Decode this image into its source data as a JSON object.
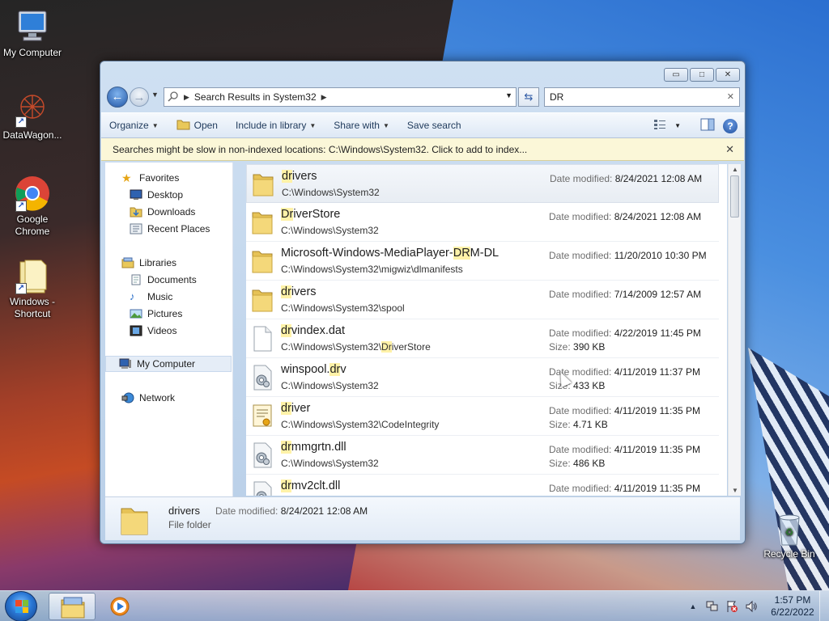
{
  "desktop": {
    "icons": [
      {
        "label": "My Computer"
      },
      {
        "label": "DataWagon..."
      },
      {
        "label": "Google Chrome"
      },
      {
        "label": "Windows - Shortcut"
      },
      {
        "label": "Recycle Bin"
      }
    ]
  },
  "window": {
    "controls": {
      "minimize": "▭",
      "maximize": "□",
      "close": "✕"
    },
    "address": {
      "breadcrumb": "Search Results in System32",
      "search_value": "DR",
      "search_clear": "✕"
    },
    "toolbar": {
      "organize": "Organize",
      "open": "Open",
      "include_in_library": "Include in library",
      "share_with": "Share with",
      "save_search": "Save search"
    },
    "infobar": {
      "text": "Searches might be slow in non-indexed locations: C:\\Windows\\System32. Click to add to index...",
      "close": "✕"
    },
    "nav": {
      "favorites": "Favorites",
      "desktop": "Desktop",
      "downloads": "Downloads",
      "recent_places": "Recent Places",
      "libraries": "Libraries",
      "documents": "Documents",
      "music": "Music",
      "pictures": "Pictures",
      "videos": "Videos",
      "my_computer": "My Computer",
      "network": "Network"
    },
    "labels": {
      "date_modified": "Date modified:",
      "size": "Size:"
    },
    "files": [
      {
        "name_hl": "dr",
        "name_rest": "ivers",
        "name_pre": "",
        "path": "C:\\Windows\\System32",
        "path_hl": "",
        "path_post": "",
        "date": "8/24/2021 12:08 AM",
        "size": "",
        "icon": "folder-icon"
      },
      {
        "name_hl": "Dr",
        "name_rest": "iverStore",
        "name_pre": "",
        "path": "C:\\Windows\\System32",
        "path_hl": "",
        "path_post": "",
        "date": "8/24/2021 12:08 AM",
        "size": "",
        "icon": "folder-icon"
      },
      {
        "name_pre": "Microsoft-Windows-MediaPlayer-",
        "name_hl": "DR",
        "name_rest": "M-DL",
        "path": "C:\\Windows\\System32\\migwiz\\dlmanifests",
        "path_hl": "",
        "path_post": "",
        "date": "11/20/2010 10:30 PM",
        "size": "",
        "icon": "folder-icon"
      },
      {
        "name_hl": "dr",
        "name_rest": "ivers",
        "name_pre": "",
        "path": "C:\\Windows\\System32\\spool",
        "path_hl": "",
        "path_post": "",
        "date": "7/14/2009 12:57 AM",
        "size": "",
        "icon": "folder-icon"
      },
      {
        "name_hl": "dr",
        "name_rest": "vindex.dat",
        "name_pre": "",
        "path": "C:\\Windows\\System32\\",
        "path_hl": "Dr",
        "path_post": "iverStore",
        "date": "4/22/2019 11:45 PM",
        "size": "390 KB",
        "icon": "file-icon"
      },
      {
        "name_pre": "winspool.",
        "name_hl": "dr",
        "name_rest": "v",
        "path": "C:\\Windows\\System32",
        "path_hl": "",
        "path_post": "",
        "date": "4/11/2019 11:37 PM",
        "size": "433 KB",
        "icon": "system-file-icon"
      },
      {
        "name_hl": "dr",
        "name_rest": "iver",
        "name_pre": "",
        "path": "C:\\Windows\\System32\\CodeIntegrity",
        "path_hl": "",
        "path_post": "",
        "date": "4/11/2019 11:35 PM",
        "size": "4.71 KB",
        "icon": "certificate-icon"
      },
      {
        "name_hl": "dr",
        "name_rest": "mmgrtn.dll",
        "name_pre": "",
        "path": "C:\\Windows\\System32",
        "path_hl": "",
        "path_post": "",
        "date": "4/11/2019 11:35 PM",
        "size": "486 KB",
        "icon": "system-file-icon"
      },
      {
        "name_hl": "dr",
        "name_rest": "mv2clt.dll",
        "name_pre": "",
        "path": "",
        "path_hl": "",
        "path_post": "",
        "date": "4/11/2019 11:35 PM",
        "size": "",
        "icon": "system-file-icon"
      }
    ],
    "details": {
      "name": "drivers",
      "date_label": "Date modified:",
      "date": "8/24/2021 12:08 AM",
      "type": "File folder"
    }
  },
  "taskbar": {
    "clock_time": "1:57 PM",
    "clock_date": "6/22/2022"
  },
  "colors": {
    "highlight": "#fff2a8",
    "accent": "#2357a6"
  }
}
